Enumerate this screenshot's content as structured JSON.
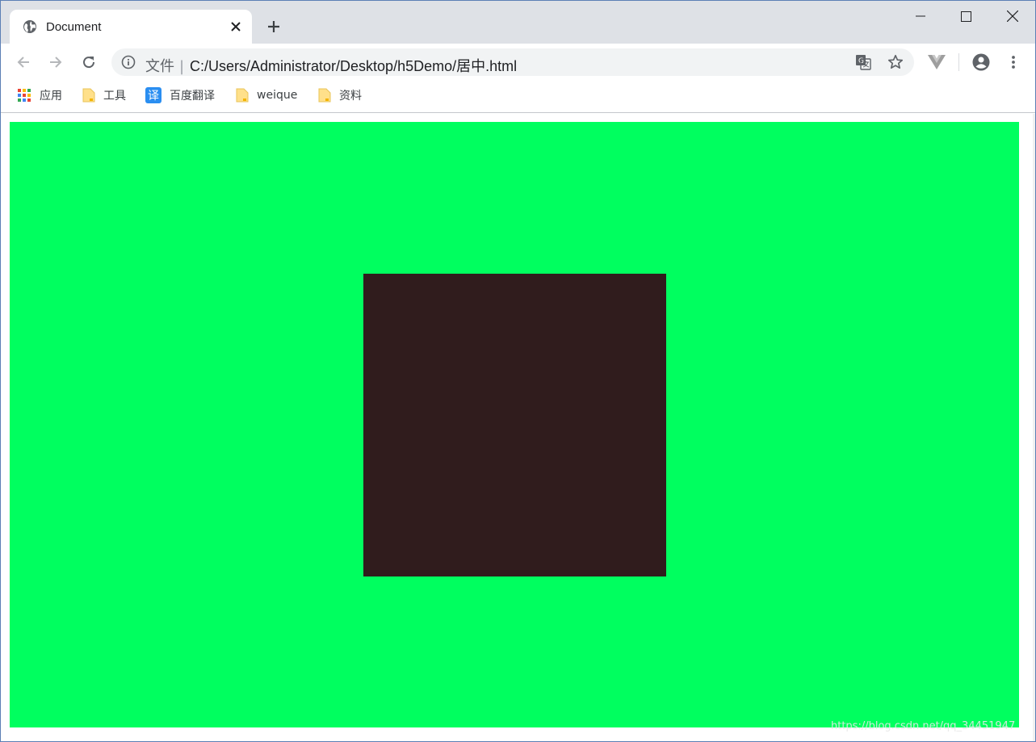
{
  "tab": {
    "title": "Document",
    "favicon": "globe-icon"
  },
  "window_controls": {
    "minimize": "minimize-icon",
    "maximize": "maximize-icon",
    "close": "close-icon"
  },
  "omnibox": {
    "scheme_label": "文件",
    "url": "C:/Users/Administrator/Desktop/h5Demo/居中.html"
  },
  "bookmarks": [
    {
      "label": "应用",
      "icon": "apps-grid-icon"
    },
    {
      "label": "工具",
      "icon": "folder-icon"
    },
    {
      "label": "百度翻译",
      "icon": "translate-badge-icon",
      "badge": "译"
    },
    {
      "label": "weique",
      "icon": "folder-icon"
    },
    {
      "label": "资料",
      "icon": "folder-icon"
    }
  ],
  "page": {
    "outer_color": "#00ff5f",
    "inner_color": "#301c1d"
  },
  "watermark": "https://blog.csdn.net/qq_34451947"
}
